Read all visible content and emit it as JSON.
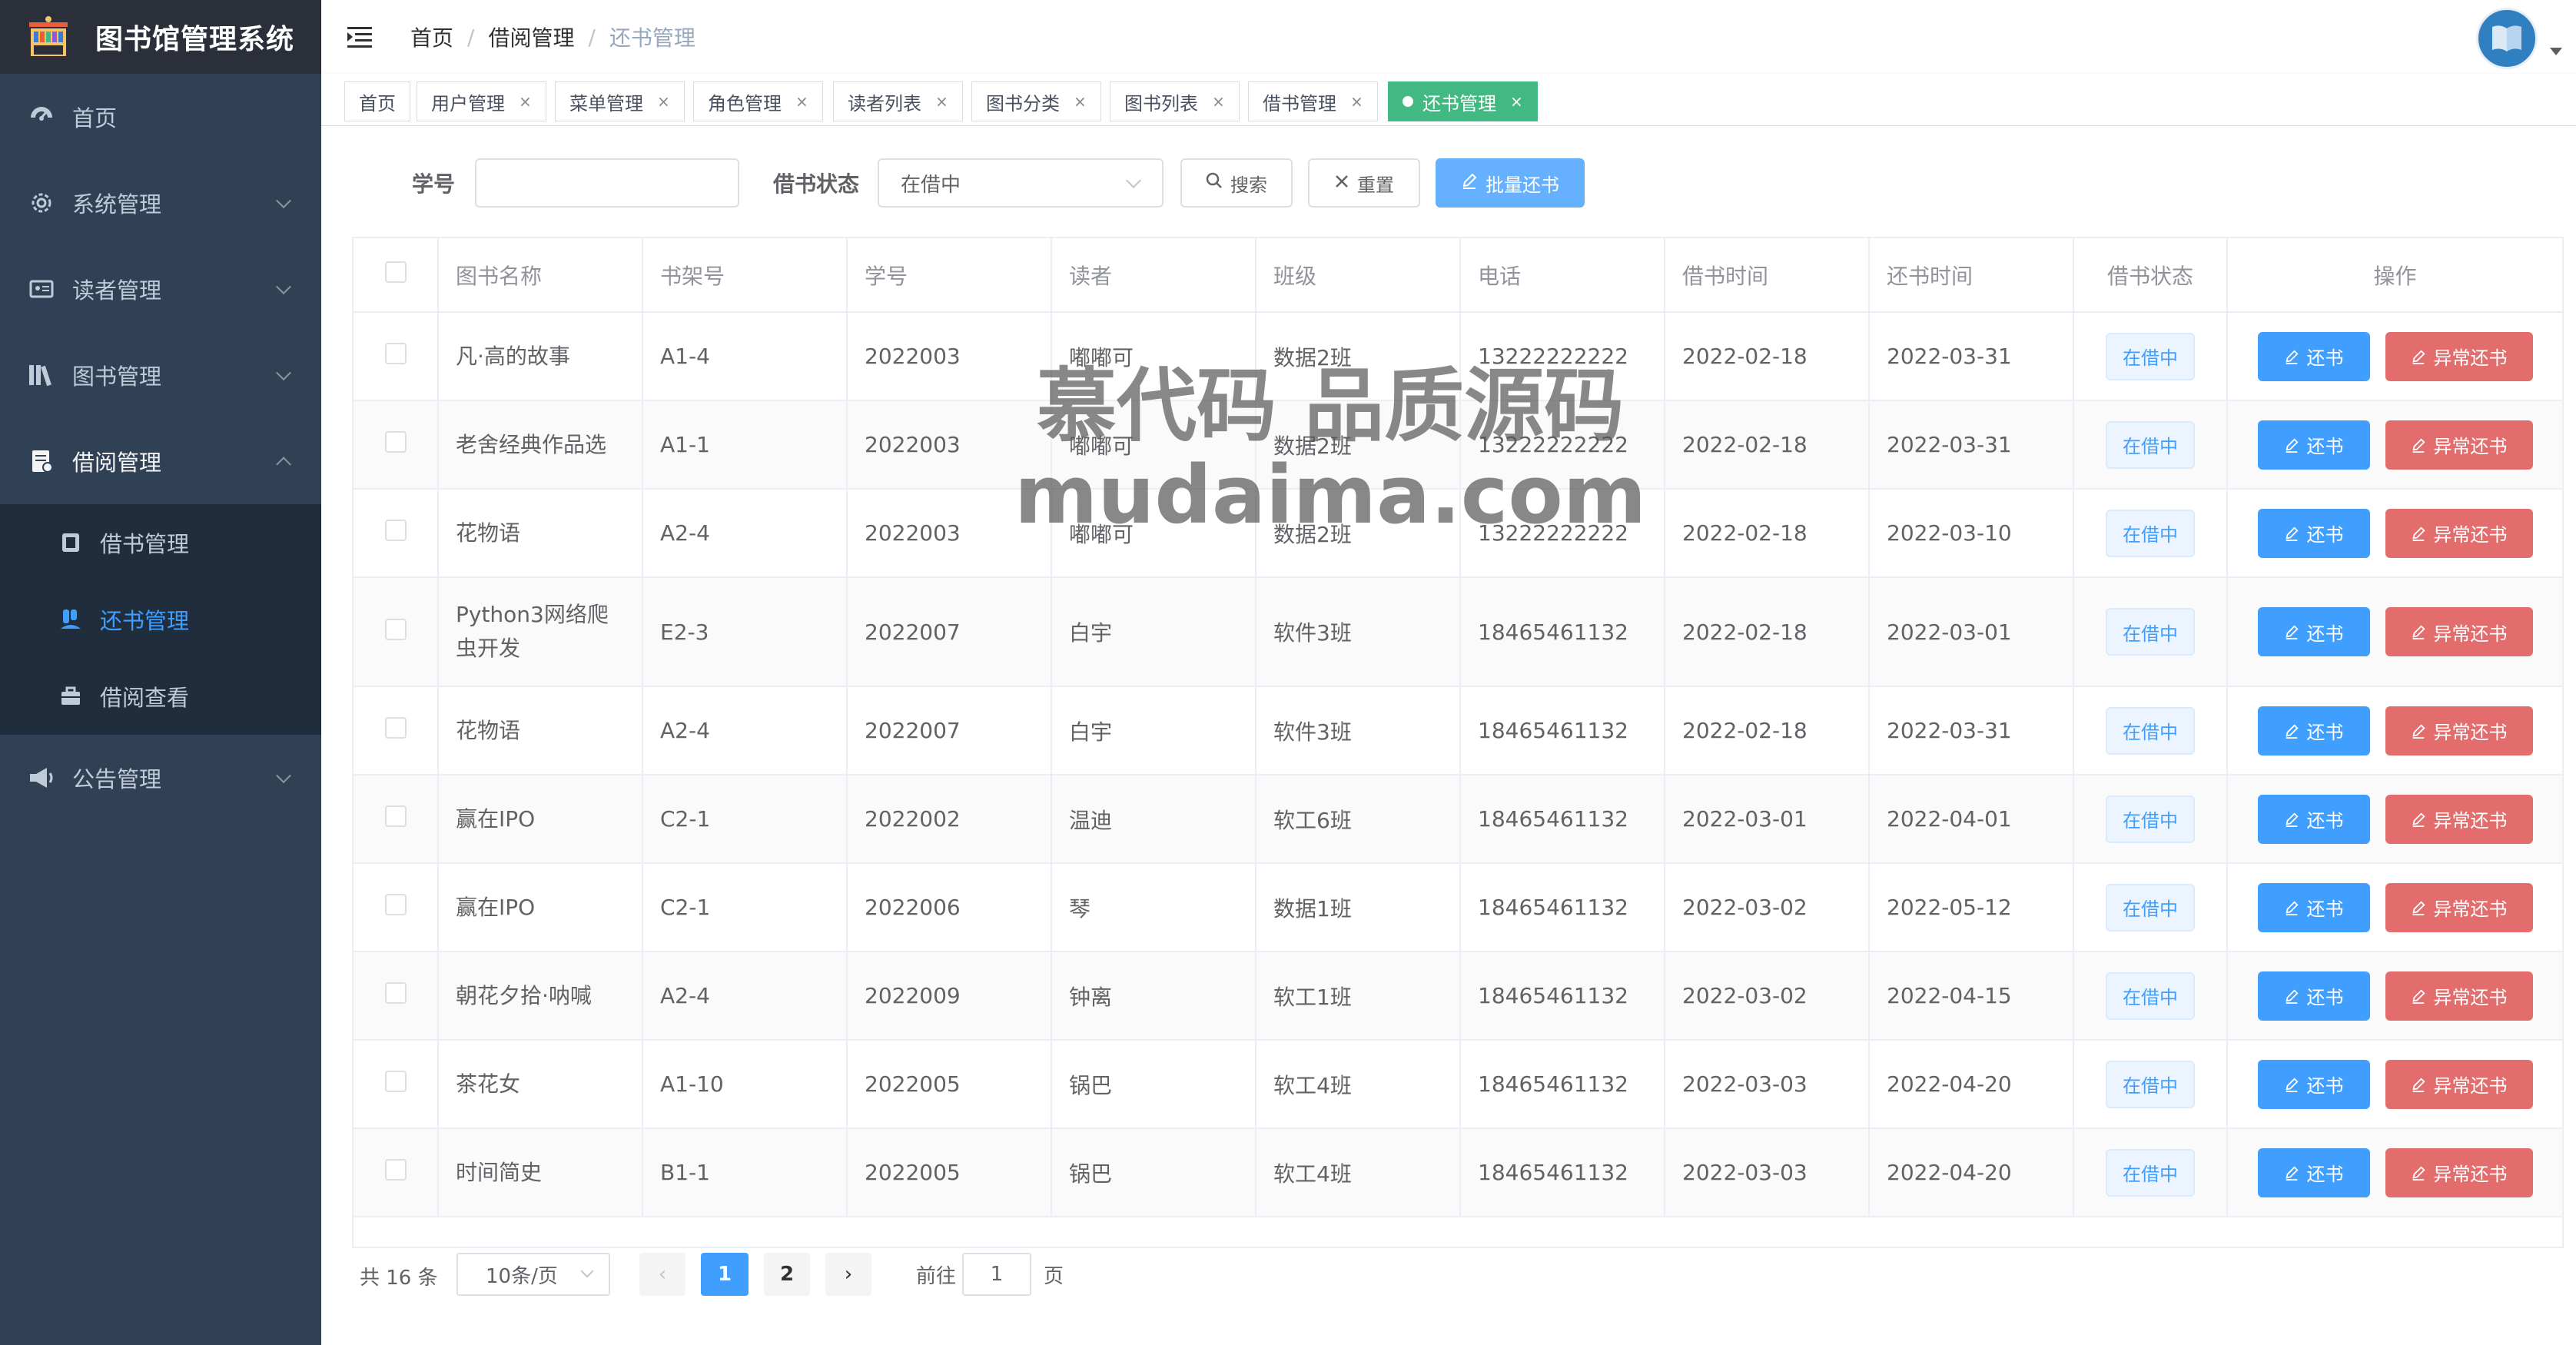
{
  "app": {
    "title": "图书馆管理系统"
  },
  "sidebar": {
    "items": [
      {
        "label": "首页",
        "icon": "dashboard-icon"
      },
      {
        "label": "系统管理",
        "icon": "gear-icon"
      },
      {
        "label": "读者管理",
        "icon": "reader-card-icon"
      },
      {
        "label": "图书管理",
        "icon": "books-icon"
      },
      {
        "label": "借阅管理",
        "icon": "borrow-doc-icon",
        "expanded": true
      },
      {
        "label": "公告管理",
        "icon": "megaphone-icon"
      }
    ],
    "subitems": [
      {
        "label": "借书管理",
        "icon": "book-icon"
      },
      {
        "label": "还书管理",
        "icon": "users-icon",
        "active": true
      },
      {
        "label": "借阅查看",
        "icon": "briefcase-icon"
      }
    ]
  },
  "breadcrumb": [
    "首页",
    "借阅管理",
    "还书管理"
  ],
  "tags": [
    "首页",
    "用户管理",
    "菜单管理",
    "角色管理",
    "读者列表",
    "图书分类",
    "图书列表",
    "借书管理",
    "还书管理"
  ],
  "tag_close": "×",
  "search": {
    "student_label": "学号",
    "student_value": "",
    "status_label": "借书状态",
    "status_value": "在借中",
    "search_btn": "搜索",
    "reset_btn": "重置",
    "batch_btn": "批量还书"
  },
  "table": {
    "headers": [
      "图书名称",
      "书架号",
      "学号",
      "读者",
      "班级",
      "电话",
      "借书时间",
      "还书时间",
      "借书状态",
      "操作"
    ],
    "rows": [
      [
        "凡·高的故事",
        "A1-4",
        "2022003",
        "嘟嘟可",
        "数据2班",
        "13222222222",
        "2022-02-18",
        "2022-03-31",
        "在借中"
      ],
      [
        "老舍经典作品选",
        "A1-1",
        "2022003",
        "嘟嘟可",
        "数据2班",
        "13222222222",
        "2022-02-18",
        "2022-03-31",
        "在借中"
      ],
      [
        "花物语",
        "A2-4",
        "2022003",
        "嘟嘟可",
        "数据2班",
        "13222222222",
        "2022-02-18",
        "2022-03-10",
        "在借中"
      ],
      [
        "Python3网络爬虫开发",
        "E2-3",
        "2022007",
        "白宇",
        "软件3班",
        "18465461132",
        "2022-02-18",
        "2022-03-01",
        "在借中"
      ],
      [
        "花物语",
        "A2-4",
        "2022007",
        "白宇",
        "软件3班",
        "18465461132",
        "2022-02-18",
        "2022-03-31",
        "在借中"
      ],
      [
        "赢在IPO",
        "C2-1",
        "2022002",
        "温迪",
        "软工6班",
        "18465461132",
        "2022-03-01",
        "2022-04-01",
        "在借中"
      ],
      [
        "赢在IPO",
        "C2-1",
        "2022006",
        "琴",
        "数据1班",
        "18465461132",
        "2022-03-02",
        "2022-05-12",
        "在借中"
      ],
      [
        "朝花夕拾·呐喊",
        "A2-4",
        "2022009",
        "钟离",
        "软工1班",
        "18465461132",
        "2022-03-02",
        "2022-04-15",
        "在借中"
      ],
      [
        "茶花女",
        "A1-10",
        "2022005",
        "锅巴",
        "软工4班",
        "18465461132",
        "2022-03-03",
        "2022-04-20",
        "在借中"
      ],
      [
        "时间简史",
        "B1-1",
        "2022005",
        "锅巴",
        "软工4班",
        "18465461132",
        "2022-03-03",
        "2022-04-20",
        "在借中"
      ]
    ],
    "return_btn": "还书",
    "abnormal_btn": "异常还书"
  },
  "pagination": {
    "total": "共 16 条",
    "page_size": "10条/页",
    "pages": [
      "1",
      "2"
    ],
    "current": "1",
    "goto_label": "前往",
    "goto_value": "1",
    "page_suffix": "页"
  },
  "watermark": {
    "line1": "慕代码 品质源码",
    "line2": "mudaima.com"
  },
  "colors": {
    "sidebar": "#304156",
    "accent": "#409eff",
    "danger": "#e36d6d",
    "tag_active": "#42b983"
  }
}
